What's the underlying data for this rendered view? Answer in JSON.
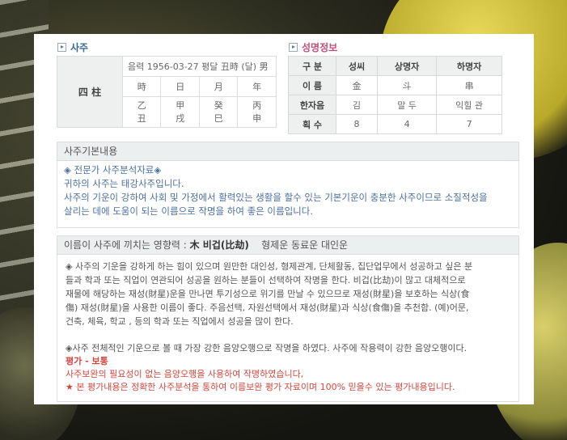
{
  "saju": {
    "title": "사주",
    "label": "四 柱",
    "info": "음력 1956-03-27 평달 丑時 (달) 男",
    "headers": [
      "時",
      "日",
      "月",
      "年"
    ],
    "stems": [
      "乙",
      "甲",
      "癸",
      "丙"
    ],
    "branches": [
      "丑",
      "戌",
      "巳",
      "申"
    ]
  },
  "name_info": {
    "title": "성명정보",
    "col_headers": [
      "구 분",
      "성씨",
      "상명자",
      "하명자"
    ],
    "rows": [
      {
        "label": "이 름",
        "values": [
          "金",
          "斗",
          "串"
        ]
      },
      {
        "label": "한자음",
        "values": [
          "김",
          "말 두",
          "익힐 관"
        ]
      },
      {
        "label": "획 수",
        "values": [
          "8",
          "4",
          "7"
        ]
      }
    ]
  },
  "basic": {
    "header": "사주기본내용",
    "line1": "◈ 전문가 사주분석자료◈",
    "line2": "귀하의 사주는 태강사주입니다.",
    "line3": "사주의 기운이 강하여 사회 및 가정에서 활력있는 생활을 할수 있는 기본기운이 충분한 사주이므로 소질적성을",
    "line4": "살리는 데에 도움이 되는 이름으로 작명을 하여 좋은 이름입니다."
  },
  "influence": {
    "header_prefix": "이름이 사주에 끼치는 영향력 : ",
    "header_bold": "木 비겁(比劫)",
    "header_suffix": "형제운 동료운 대인운",
    "para1_l1": "◈ 사주의 기운을 강하게 하는 힘이 있으며 원만한 대인성, 형제관계, 단체활동, 집단업무에서 성공하고 싶은 분",
    "para1_l2": "들과 학과 또는 직업이 연관되어 성공을 원하는 분들이 선택하여 작명을 한다. 비겁(比劫)이 많고 대체적으로",
    "para1_l3": "재물에 해당하는 재성(財星)운을 만나면 투기성으로 위기를 만날 수 있으므로 재성(財星)을 보호하는 식상(食",
    "para1_l4": "傷) 재성(財星)을 사용한 이름이 좋다. 주음선택, 자원선택에서 재성(財星)과 식상(食傷)을 추천함. (예)어문,",
    "para1_l5": "건축, 체육, 학교 , 등의 학과 또는 직업에서 성공을 많이 한다.",
    "para2_l1": "◈사주 전체적인 기운으로 볼 때 가장 강한 음양오행으로 작명을 하였다. 사주에 작용력이 강한 음양오행이다.",
    "eval": "평가 - 보통",
    "eval_l1": "사주보완의 필요성이 없는 음양오행을 사용하여 작명하였습니다,",
    "eval_l2": "★ 본 평가내용은 정확한 사주분석을 통하여 이름보완 평가 자료이며 100% 믿을수 있는 평가내용입니다."
  }
}
